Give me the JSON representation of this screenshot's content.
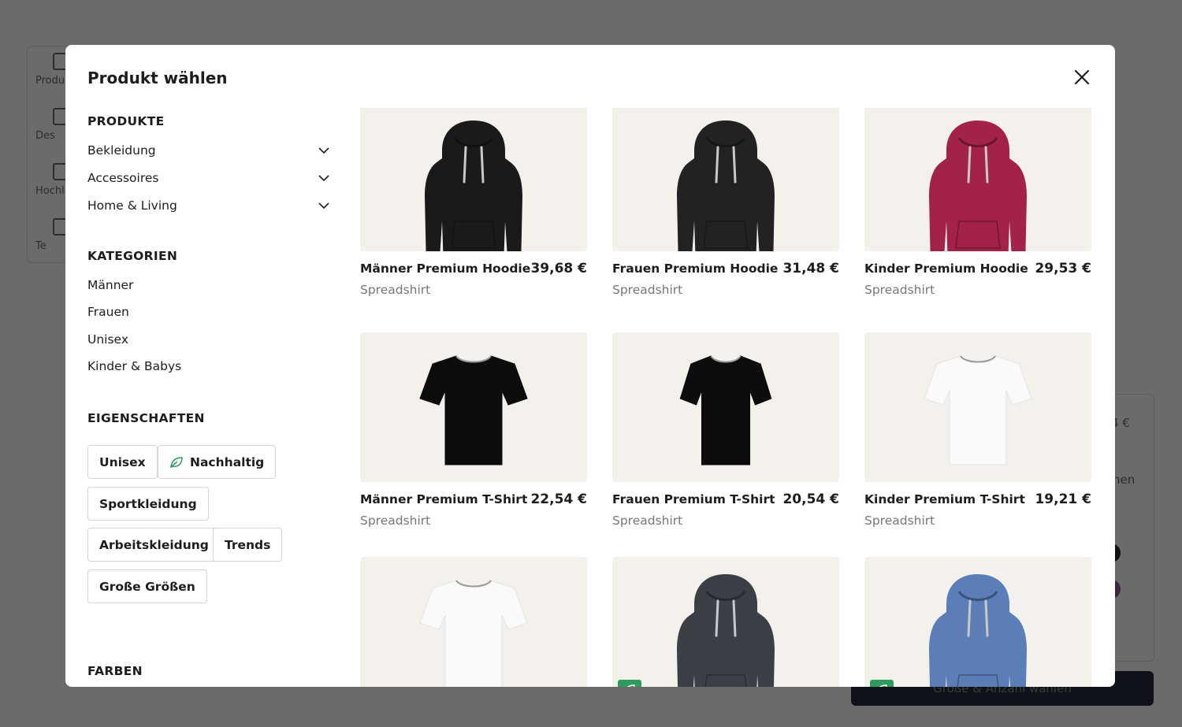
{
  "background": {
    "rail": [
      "Produ",
      "Des",
      "Hochl",
      "Te"
    ],
    "price_fragment": "4 €",
    "label_fragment": "nen",
    "cta_label": "Größe & Anzahl wählen"
  },
  "modal": {
    "title": "Produkt wählen",
    "close_label": "×"
  },
  "sidebar": {
    "products_heading": "PRODUKTE",
    "products": [
      {
        "label": "Bekleidung"
      },
      {
        "label": "Accessoires"
      },
      {
        "label": "Home & Living"
      }
    ],
    "categories_heading": "KATEGORIEN",
    "categories": [
      "Männer",
      "Frauen",
      "Unisex",
      "Kinder & Babys"
    ],
    "properties_heading": "EIGENSCHAFTEN",
    "properties": [
      "Unisex",
      "Nachhaltig",
      "Sportkleidung",
      "Arbeitskleidung",
      "Trends",
      "Große Größen"
    ],
    "colors_heading": "FARBEN",
    "colors": [
      "#ffffff",
      "#9a9a9a",
      "#000000",
      "#8e4fa3",
      "#2447b3",
      "#2fbcc7",
      "#1aa812"
    ],
    "colors_row2": [
      "#f1e11a",
      "#f3e3cf",
      "#7a3f16",
      "#f08a1d",
      "#d82323",
      "#f4a9b8"
    ]
  },
  "products": [
    {
      "name": "Männer Premium Hoodie",
      "price": "39,68 €",
      "brand": "Spreadshirt",
      "color": "#1a1a1a",
      "shape": "hoodie"
    },
    {
      "name": "Frauen Premium Hoodie",
      "price": "31,48 €",
      "brand": "Spreadshirt",
      "color": "#222222",
      "shape": "hoodie"
    },
    {
      "name": "Kinder Premium Hoodie",
      "price": "29,53 €",
      "brand": "Spreadshirt",
      "color": "#a3224a",
      "shape": "hoodie"
    },
    {
      "name": "Männer Premium T-Shirt",
      "price": "22,54 €",
      "brand": "Spreadshirt",
      "color": "#0c0c0c",
      "shape": "tshirt"
    },
    {
      "name": "Frauen Premium T-Shirt",
      "price": "20,54 €",
      "brand": "Spreadshirt",
      "color": "#0c0c0c",
      "shape": "tshirt-women"
    },
    {
      "name": "Kinder Premium T-Shirt",
      "price": "19,21 €",
      "brand": "Spreadshirt",
      "color": "#fafafa",
      "shape": "tshirt"
    },
    {
      "name": "",
      "price": "",
      "brand": "",
      "color": "#fafafa",
      "shape": "tshirt"
    },
    {
      "name": "",
      "price": "",
      "brand": "",
      "color": "#3d3f46",
      "shape": "hoodie",
      "eco": true
    },
    {
      "name": "",
      "price": "",
      "brand": "",
      "color": "#5b7db8",
      "shape": "hoodie",
      "eco": true
    }
  ]
}
